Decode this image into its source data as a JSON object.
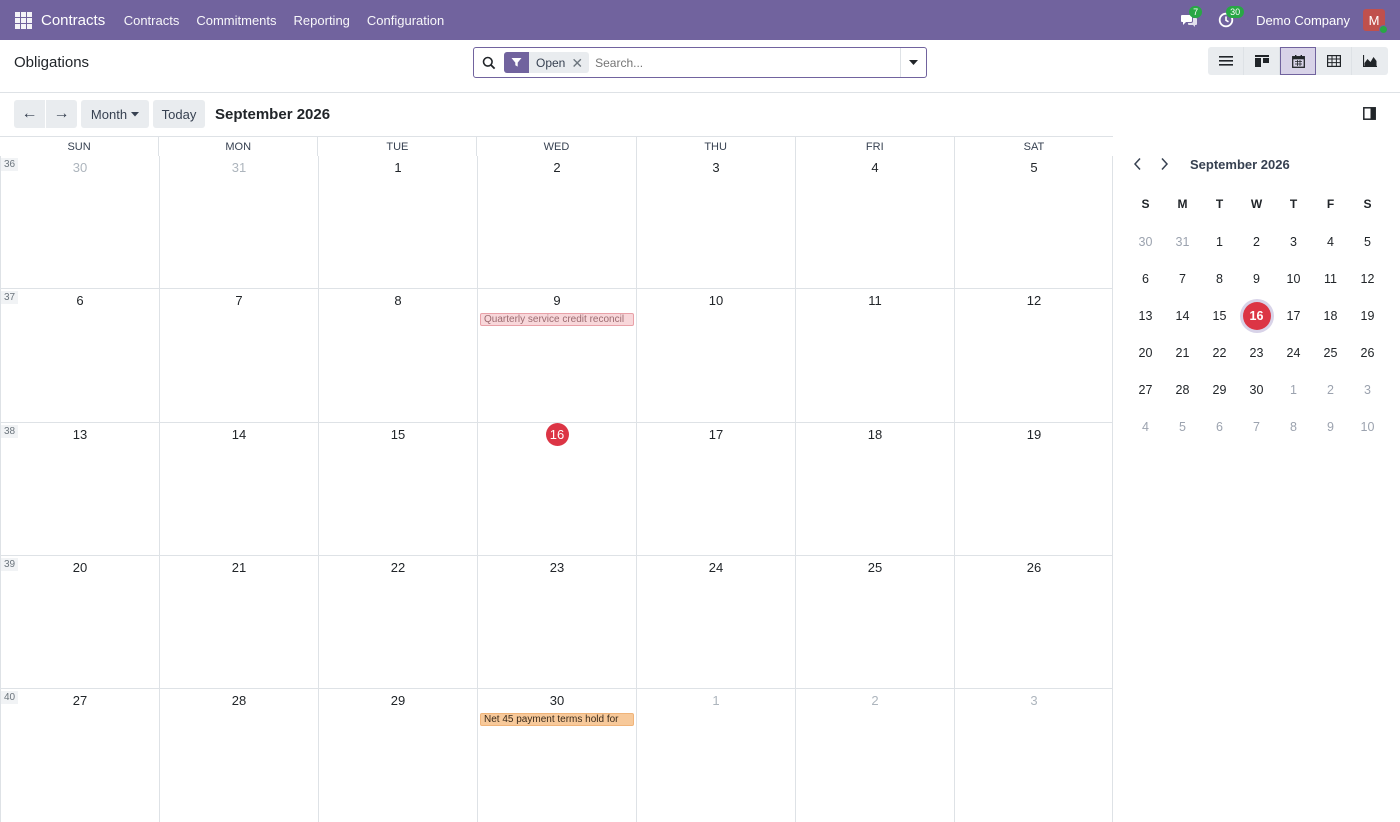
{
  "navbar": {
    "brand": "Contracts",
    "menu": [
      "Contracts",
      "Commitments",
      "Reporting",
      "Configuration"
    ],
    "messages_badge": "7",
    "activities_badge": "30",
    "company": "Demo Company",
    "avatar_letter": "M"
  },
  "control_panel": {
    "title": "Obligations",
    "facet": "Open",
    "search_placeholder": "Search..."
  },
  "calendar": {
    "prev_label": "←",
    "next_label": "→",
    "scale": "Month",
    "today_label": "Today",
    "period": "September 2026",
    "weekdays": [
      "SUN",
      "MON",
      "TUE",
      "WED",
      "THU",
      "FRI",
      "SAT"
    ],
    "weeks": [
      {
        "num": "36",
        "days": [
          {
            "d": "30",
            "other": true
          },
          {
            "d": "31",
            "other": true
          },
          {
            "d": "1"
          },
          {
            "d": "2"
          },
          {
            "d": "3"
          },
          {
            "d": "4"
          },
          {
            "d": "5"
          }
        ]
      },
      {
        "num": "37",
        "days": [
          {
            "d": "6"
          },
          {
            "d": "7"
          },
          {
            "d": "8"
          },
          {
            "d": "9",
            "event": {
              "title": "Quarterly service credit reconcil",
              "color": "red"
            }
          },
          {
            "d": "10"
          },
          {
            "d": "11"
          },
          {
            "d": "12"
          }
        ]
      },
      {
        "num": "38",
        "days": [
          {
            "d": "13"
          },
          {
            "d": "14"
          },
          {
            "d": "15"
          },
          {
            "d": "16",
            "today": true
          },
          {
            "d": "17"
          },
          {
            "d": "18"
          },
          {
            "d": "19"
          }
        ]
      },
      {
        "num": "39",
        "days": [
          {
            "d": "20"
          },
          {
            "d": "21"
          },
          {
            "d": "22"
          },
          {
            "d": "23"
          },
          {
            "d": "24"
          },
          {
            "d": "25"
          },
          {
            "d": "26"
          }
        ]
      },
      {
        "num": "40",
        "days": [
          {
            "d": "27"
          },
          {
            "d": "28"
          },
          {
            "d": "29"
          },
          {
            "d": "30",
            "event": {
              "title": "Net 45 payment terms hold for",
              "color": "orange"
            }
          },
          {
            "d": "1",
            "other": true
          },
          {
            "d": "2",
            "other": true
          },
          {
            "d": "3",
            "other": true
          }
        ]
      }
    ]
  },
  "mini_calendar": {
    "title": "September 2026",
    "dow": [
      "S",
      "M",
      "T",
      "W",
      "T",
      "F",
      "S"
    ],
    "rows": [
      [
        {
          "d": "30",
          "other": true
        },
        {
          "d": "31",
          "other": true
        },
        {
          "d": "1"
        },
        {
          "d": "2"
        },
        {
          "d": "3"
        },
        {
          "d": "4"
        },
        {
          "d": "5"
        }
      ],
      [
        {
          "d": "6"
        },
        {
          "d": "7"
        },
        {
          "d": "8"
        },
        {
          "d": "9"
        },
        {
          "d": "10"
        },
        {
          "d": "11"
        },
        {
          "d": "12"
        }
      ],
      [
        {
          "d": "13"
        },
        {
          "d": "14"
        },
        {
          "d": "15"
        },
        {
          "d": "16",
          "today": true
        },
        {
          "d": "17"
        },
        {
          "d": "18"
        },
        {
          "d": "19"
        }
      ],
      [
        {
          "d": "20"
        },
        {
          "d": "21"
        },
        {
          "d": "22"
        },
        {
          "d": "23"
        },
        {
          "d": "24"
        },
        {
          "d": "25"
        },
        {
          "d": "26"
        }
      ],
      [
        {
          "d": "27"
        },
        {
          "d": "28"
        },
        {
          "d": "29"
        },
        {
          "d": "30"
        },
        {
          "d": "1",
          "other": true
        },
        {
          "d": "2",
          "other": true
        },
        {
          "d": "3",
          "other": true
        }
      ],
      [
        {
          "d": "4",
          "other": true
        },
        {
          "d": "5",
          "other": true
        },
        {
          "d": "6",
          "other": true
        },
        {
          "d": "7",
          "other": true
        },
        {
          "d": "8",
          "other": true
        },
        {
          "d": "9",
          "other": true
        },
        {
          "d": "10",
          "other": true
        }
      ]
    ]
  },
  "colors": {
    "brand": "#71639e",
    "today": "#dc3545",
    "event_red_bg": "#f8d7da",
    "event_orange_bg": "#f7c99a"
  }
}
